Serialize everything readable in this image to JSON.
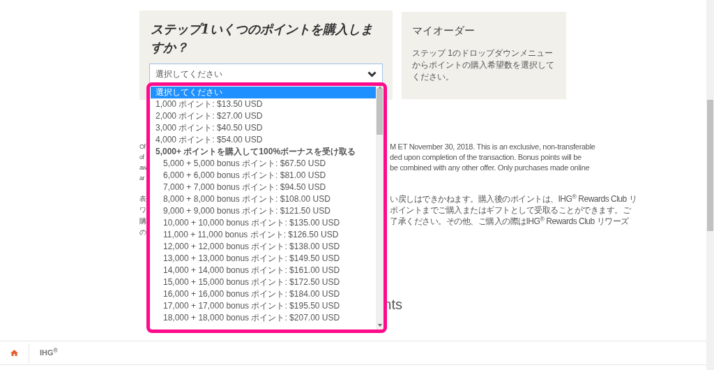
{
  "step_panel": {
    "title": "ステップ1いくつのポイントを購入しますか？",
    "select": {
      "value": "選択してください"
    }
  },
  "order_panel": {
    "title": "マイオーダー",
    "text": "ステップ 1のドロップダウンメニューからポイントの購入希望数を選択してください。"
  },
  "dropdown": {
    "options": [
      {
        "label": "選択してください",
        "kind": "option",
        "selected": true
      },
      {
        "label": "1,000 ポイント: $13.50 USD",
        "kind": "option",
        "selected": false
      },
      {
        "label": "2,000 ポイント: $27.00 USD",
        "kind": "option",
        "selected": false
      },
      {
        "label": "3,000 ポイント: $40.50 USD",
        "kind": "option",
        "selected": false
      },
      {
        "label": "4,000 ポイント: $54.00 USD",
        "kind": "option",
        "selected": false
      },
      {
        "label": "5,000+ ポイントを購入して100%ボーナスを受け取る",
        "kind": "group",
        "selected": false
      },
      {
        "label": "5,000 + 5,000 bonus ポイント: $67.50 USD",
        "kind": "suboption",
        "selected": false
      },
      {
        "label": "6,000 + 6,000 bonus ポイント: $81.00 USD",
        "kind": "suboption",
        "selected": false
      },
      {
        "label": "7,000 + 7,000 bonus ポイント: $94.50 USD",
        "kind": "suboption",
        "selected": false
      },
      {
        "label": "8,000 + 8,000 bonus ポイント: $108.00 USD",
        "kind": "suboption",
        "selected": false
      },
      {
        "label": "9,000 + 9,000 bonus ポイント: $121.50 USD",
        "kind": "suboption",
        "selected": false
      },
      {
        "label": "10,000 + 10,000 bonus ポイント: $135.00 USD",
        "kind": "suboption",
        "selected": false
      },
      {
        "label": "11,000 + 11,000 bonus ポイント: $126.50 USD",
        "kind": "suboption",
        "selected": false
      },
      {
        "label": "12,000 + 12,000 bonus ポイント: $138.00 USD",
        "kind": "suboption",
        "selected": false
      },
      {
        "label": "13,000 + 13,000 bonus ポイント: $149.50 USD",
        "kind": "suboption",
        "selected": false
      },
      {
        "label": "14,000 + 14,000 bonus ポイント: $161.00 USD",
        "kind": "suboption",
        "selected": false
      },
      {
        "label": "15,000 + 15,000 bonus ポイント: $172.50 USD",
        "kind": "suboption",
        "selected": false
      },
      {
        "label": "16,000 + 16,000 bonus ポイント: $184.00 USD",
        "kind": "suboption",
        "selected": false
      },
      {
        "label": "17,000 + 17,000 bonus ポイント: $195.50 USD",
        "kind": "suboption",
        "selected": false
      },
      {
        "label": "18,000 + 18,000 bonus ポイント: $207.00 USD",
        "kind": "suboption",
        "selected": false
      }
    ]
  },
  "background_text": {
    "paragraphs": [
      {
        "kind": "latin",
        "lines": [
          {
            "left": "Of",
            "right": "M ET November 30, 2018. This is an exclusive, non-transferable"
          },
          {
            "left": "of",
            "right": "ded upon completion of the transaction. Bonus points will be"
          },
          {
            "left": "aw",
            "right": "be combined with any other offer. Only purchases made online"
          },
          {
            "left": "ar"
          }
        ]
      },
      {
        "kind": "cjk",
        "lines": [
          {
            "left": "表",
            "right": "い戻しはできかねます。購入後のポイントは、IHG$^{®}$ Rewards Club リ"
          },
          {
            "left": "ワ",
            "right": "ポイントまでご購入またはギフトとして受取ることができます。ご"
          },
          {
            "left": "購",
            "right": "了承ください。その他、ご購入の際はIHG$^{®}$ Rewards Club リワーズ"
          },
          {
            "left": "の"
          }
        ]
      }
    ]
  },
  "heading_fragment": "nts",
  "footer": {
    "brand": "IHG$^{®}$"
  }
}
